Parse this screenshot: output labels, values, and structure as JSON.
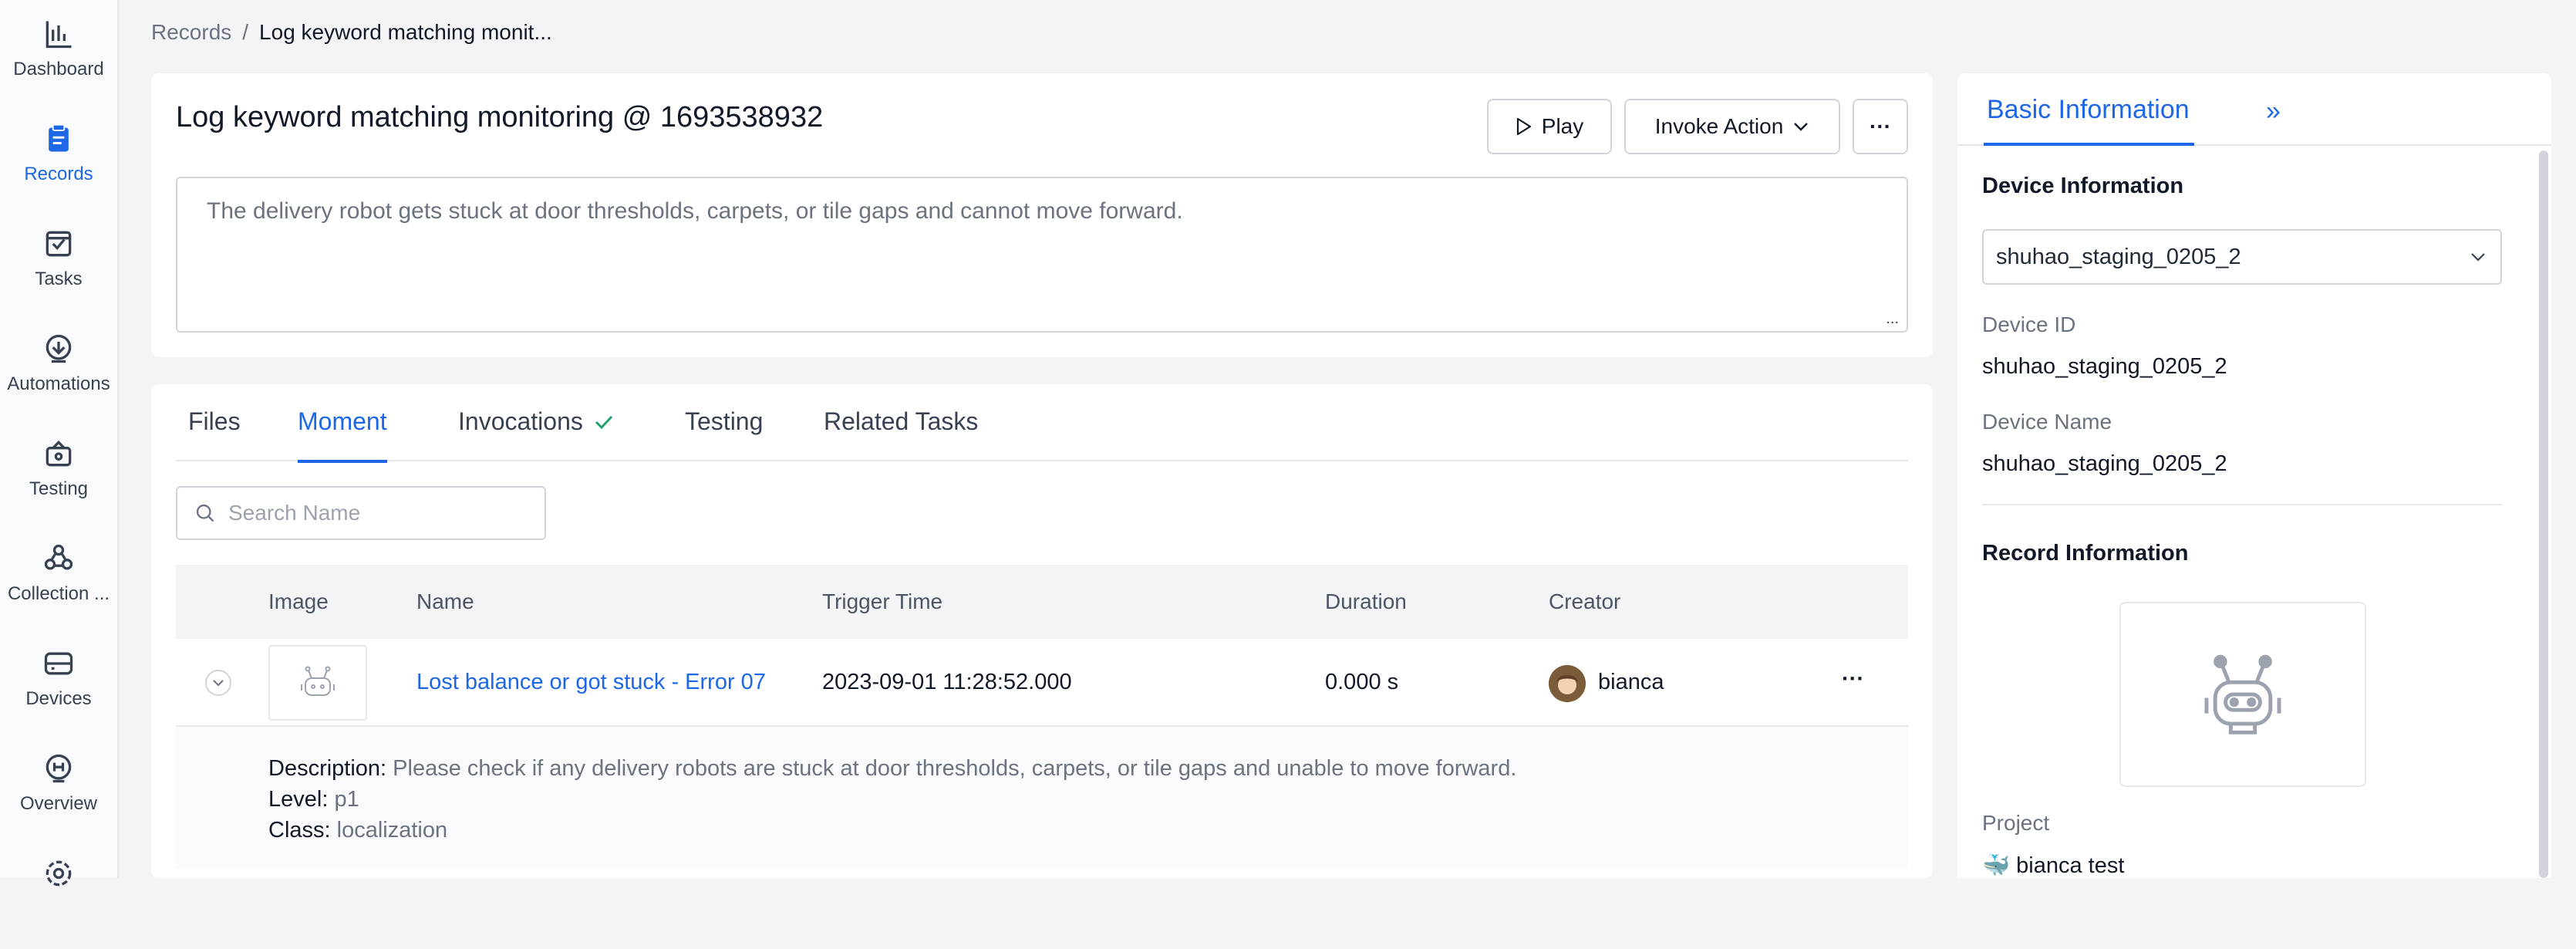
{
  "sidebar": {
    "items": [
      {
        "label": "Dashboard",
        "icon": "chart-bars-icon"
      },
      {
        "label": "Records",
        "icon": "document-icon"
      },
      {
        "label": "Tasks",
        "icon": "task-check-icon"
      },
      {
        "label": "Automations",
        "icon": "automation-icon"
      },
      {
        "label": "Testing",
        "icon": "testing-icon"
      },
      {
        "label": "Collection ...",
        "icon": "collection-icon"
      },
      {
        "label": "Devices",
        "icon": "device-icon"
      },
      {
        "label": "Overview",
        "icon": "overview-icon"
      }
    ]
  },
  "breadcrumb": {
    "root": "Records",
    "sep": "/",
    "current": "Log keyword matching monit..."
  },
  "record": {
    "title": "Log keyword matching monitoring @ 1693538932",
    "description": "The delivery robot gets stuck at door thresholds, carpets, or tile gaps and cannot move forward.",
    "resize_glyph": "..."
  },
  "toolbar": {
    "play_label": "Play",
    "invoke_label": "Invoke Action",
    "more_label": "···"
  },
  "tabs": [
    "Files",
    "Moment",
    "Invocations",
    "Testing",
    "Related Tasks"
  ],
  "search": {
    "placeholder": "Search Name"
  },
  "table": {
    "columns": [
      "Image",
      "Name",
      "Trigger Time",
      "Duration",
      "Creator"
    ],
    "rows": [
      {
        "name": "Lost balance or got stuck - Error 07",
        "trigger_time": "2023-09-01 11:28:52.000",
        "duration": "0.000 s",
        "creator": "bianca",
        "more": "···"
      }
    ],
    "expanded": {
      "description_label": "Description:",
      "description": " Please check if any delivery robots are stuck at door thresholds, carpets, or tile gaps and unable to move forward.",
      "level_label": "Level:",
      "level": " p1",
      "class_label": "Class:",
      "class": " localization"
    }
  },
  "panel": {
    "tab": "Basic Information",
    "collapse_glyph": "»",
    "device_section": "Device Information",
    "device_select": "shuhao_staging_0205_2",
    "device_id_label": "Device ID",
    "device_id": "shuhao_staging_0205_2",
    "device_name_label": "Device Name",
    "device_name": "shuhao_staging_0205_2",
    "record_section": "Record Information",
    "project_label": "Project",
    "project_icon": "🐳",
    "project": "bianca test"
  },
  "colors": {
    "accent": "#1d66e5",
    "success": "#22a06b"
  }
}
